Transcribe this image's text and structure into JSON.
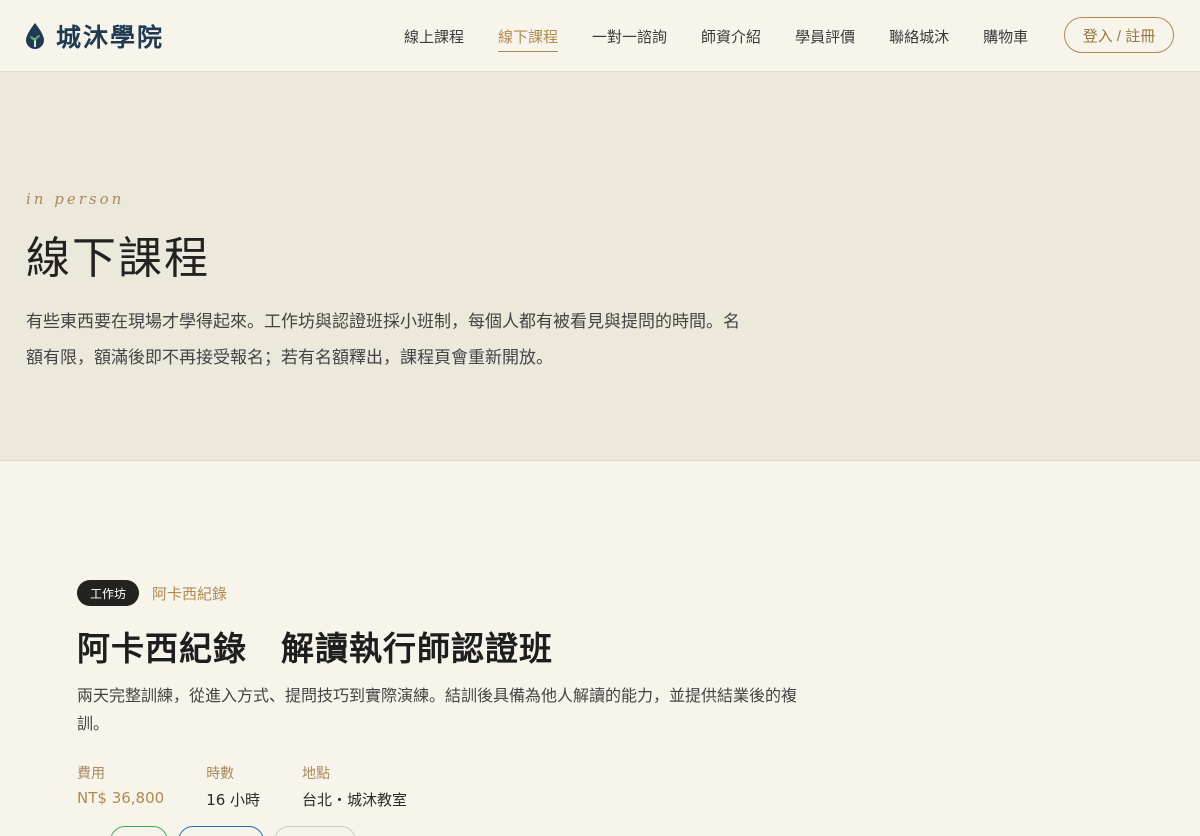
{
  "brand": {
    "name": "城沐學院",
    "logo_icon": "drop-sprout-icon"
  },
  "nav": {
    "items": [
      {
        "label": "線上課程",
        "active": false
      },
      {
        "label": "線下課程",
        "active": true
      },
      {
        "label": "一對一諮詢",
        "active": false
      },
      {
        "label": "師資介紹",
        "active": false
      },
      {
        "label": "學員評價",
        "active": false
      },
      {
        "label": "聯絡城沐",
        "active": false
      },
      {
        "label": "購物車",
        "active": false
      }
    ],
    "login_label": "登入 / 註冊"
  },
  "hero": {
    "eyebrow": "in person",
    "title": "線下課程",
    "description": "有些東西要在現場才學得起來。工作坊與認證班採小班制，每個人都有被看見與提問的時間。名額有限，額滿後即不再接受報名；若有名額釋出，課程頁會重新開放。"
  },
  "course": {
    "badge": "工作坊",
    "brand_tag": "阿卡西紀錄",
    "title": "阿卡西紀錄　解讀執行師認證班",
    "description": "兩天完整訓練，從進入方式、提問技巧到實際演練。結訓後具備為他人解讀的能力，並提供結業後的複訓。",
    "meta": {
      "fee_label": "費用",
      "fee_value": "NT$ 36,800",
      "hours_label": "時數",
      "hours_value": "16 小時",
      "location_label": "地點",
      "location_value": "台北・城沐教室"
    }
  },
  "colors": {
    "accent": "#b08a4f",
    "brand_navy": "#1f3a52",
    "hero_bg": "#ede8dc",
    "page_bg": "#f7f4ec"
  }
}
